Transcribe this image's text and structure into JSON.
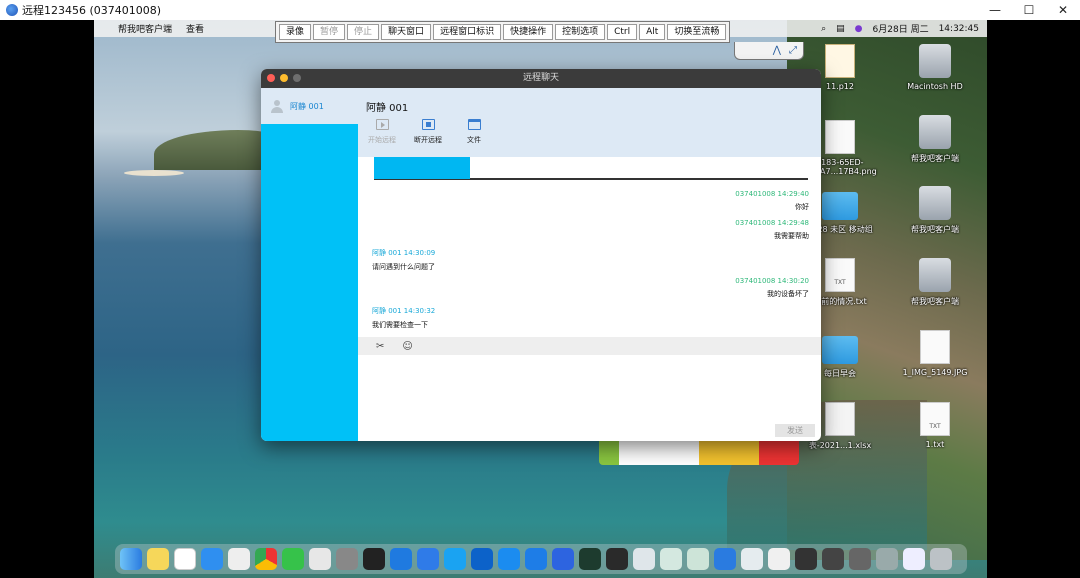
{
  "window": {
    "title": "远程123456 (037401008)",
    "controls": [
      "—",
      "☐",
      "✕"
    ]
  },
  "menubar": {
    "apple": "",
    "items": [
      "帮我吧客户端",
      "查看"
    ],
    "date": "6月28日 周二",
    "time": "14:32:45"
  },
  "toolbar": {
    "buttons": [
      {
        "label": "录像",
        "enabled": true
      },
      {
        "label": "暂停",
        "enabled": false
      },
      {
        "label": "停止",
        "enabled": false
      },
      {
        "label": "聊天窗口",
        "enabled": true
      },
      {
        "label": "远程窗口标识",
        "enabled": true
      },
      {
        "label": "快捷操作",
        "enabled": true
      },
      {
        "label": "控制选项",
        "enabled": true
      },
      {
        "label": "Ctrl",
        "enabled": true
      },
      {
        "label": "Alt",
        "enabled": true
      },
      {
        "label": "切换至流畅",
        "enabled": true
      }
    ]
  },
  "desktop": {
    "icons": [
      {
        "label": "11.p12",
        "kind": "cert"
      },
      {
        "label": "Macintosh HD",
        "kind": "disk"
      },
      {
        "label": "F183-65ED-4DAA7...17B4.png",
        "kind": "doc"
      },
      {
        "label": "帮我吧客户端",
        "kind": "disk"
      },
      {
        "label": "0428 未区 移动组",
        "kind": "folder"
      },
      {
        "label": "帮我吧客户端",
        "kind": "disk"
      },
      {
        "label": "目前的情况.txt",
        "kind": "txt"
      },
      {
        "label": "帮我吧客户端",
        "kind": "disk"
      },
      {
        "label": "每日早会",
        "kind": "folder"
      },
      {
        "label": "1_IMG_5149.JPG",
        "kind": "doc"
      },
      {
        "label": "表-2021...1.xlsx",
        "kind": "xls"
      },
      {
        "label": "1.txt",
        "kind": "txt"
      }
    ]
  },
  "chat": {
    "title": "远程聊天",
    "contact": "阿静 001",
    "header_name": "阿静 001",
    "actions": [
      {
        "label": "开始远程",
        "enabled": false
      },
      {
        "label": "断开远程",
        "enabled": true
      },
      {
        "label": "文件",
        "enabled": true
      }
    ],
    "messages": [
      {
        "side": "right",
        "meta": "037401008 14:29:40",
        "text": "你好"
      },
      {
        "side": "right",
        "meta": "037401008 14:29:48",
        "text": "我需要帮助"
      },
      {
        "side": "left",
        "meta": "阿静 001 14:30:09",
        "text": "请问遇到什么问题了"
      },
      {
        "side": "right",
        "meta": "037401008 14:30:20",
        "text": "我的设备坏了"
      },
      {
        "side": "left",
        "meta": "阿静 001 14:30:32",
        "text": "我们需要检查一下"
      }
    ],
    "input_tools": [
      "✂",
      "☺"
    ],
    "send_label": "发送"
  },
  "colors": {
    "accent": "#00c1f7",
    "header_bg": "#dde9f5"
  }
}
